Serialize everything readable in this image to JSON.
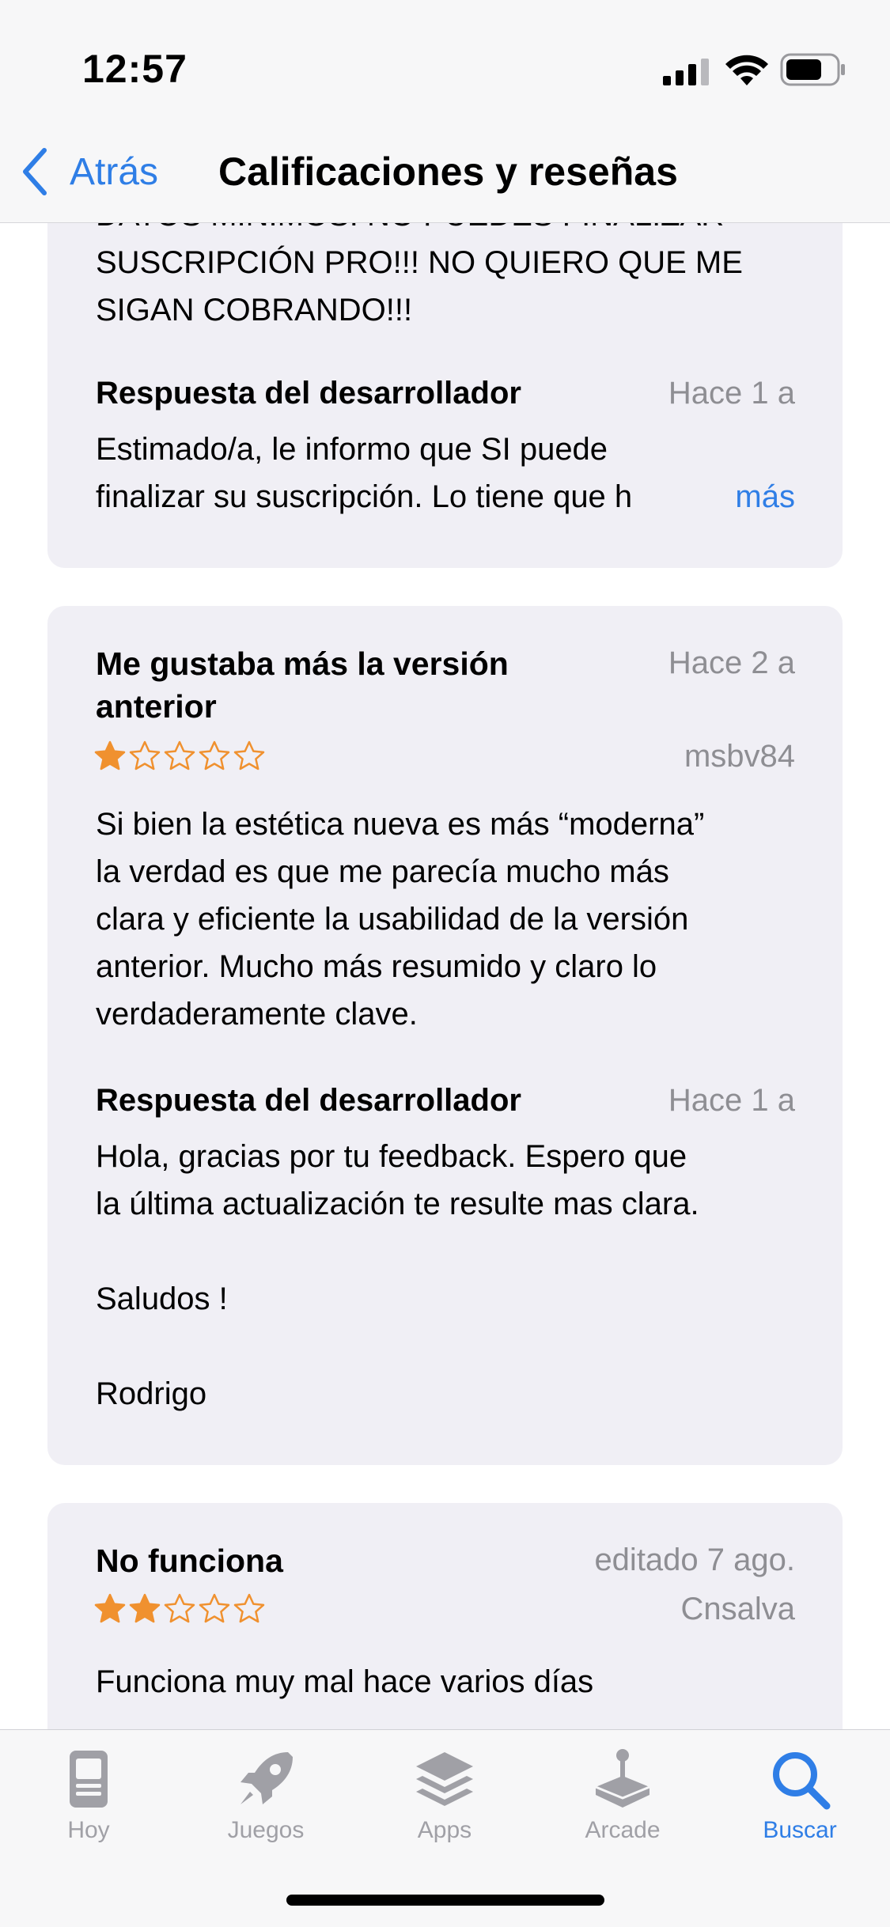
{
  "status_bar": {
    "time": "12:57"
  },
  "nav": {
    "back_label": "Atrás",
    "title": "Calificaciones y reseñas"
  },
  "reviews": [
    {
      "body_lines": [
        "DATOS MÍNIMOS. NO PUEDES FINALIZAR",
        "SUSCRIPCIÓN PRO!!! NO QUIERO QUE ME",
        "SIGAN COBRANDO!!!"
      ],
      "dev_response": {
        "label": "Respuesta del desarrollador",
        "date": "Hace 1 a",
        "lines": [
          "Estimado/a, le informo que SI puede",
          "finalizar su suscripción. Lo tiene que h"
        ],
        "more": "más"
      }
    },
    {
      "title": "Me gustaba más la versión anterior",
      "date": "Hace 2 a",
      "rating": 1,
      "author": "msbv84",
      "body_lines": [
        "Si bien la estética nueva es más “moderna”",
        "la verdad es que me parecía mucho más",
        "clara y eficiente la usabilidad de la versión",
        "anterior. Mucho más resumido y claro lo",
        "verdaderamente clave."
      ],
      "dev_response": {
        "label": "Respuesta del desarrollador",
        "date": "Hace 1 a",
        "lines": [
          "Hola, gracias por tu feedback. Espero que",
          "la última actualización te resulte mas clara.",
          "",
          "Saludos !",
          "",
          "Rodrigo"
        ]
      }
    },
    {
      "title": "No funciona",
      "date": "editado 7 ago.",
      "rating": 2,
      "author": "Cnsalva",
      "body_lines": [
        "Funciona muy mal hace varios días"
      ]
    }
  ],
  "star_max": 5,
  "colors": {
    "accent": "#2f7ee6",
    "star": "#f0912f",
    "card_bg": "#f0eff5",
    "secondary_text": "#8e8e93"
  },
  "tabs": [
    {
      "label": "Hoy",
      "icon": "today-icon",
      "active": false
    },
    {
      "label": "Juegos",
      "icon": "rocket-icon",
      "active": false
    },
    {
      "label": "Apps",
      "icon": "apps-stack-icon",
      "active": false
    },
    {
      "label": "Arcade",
      "icon": "joystick-icon",
      "active": false
    },
    {
      "label": "Buscar",
      "icon": "search-icon",
      "active": true
    }
  ]
}
